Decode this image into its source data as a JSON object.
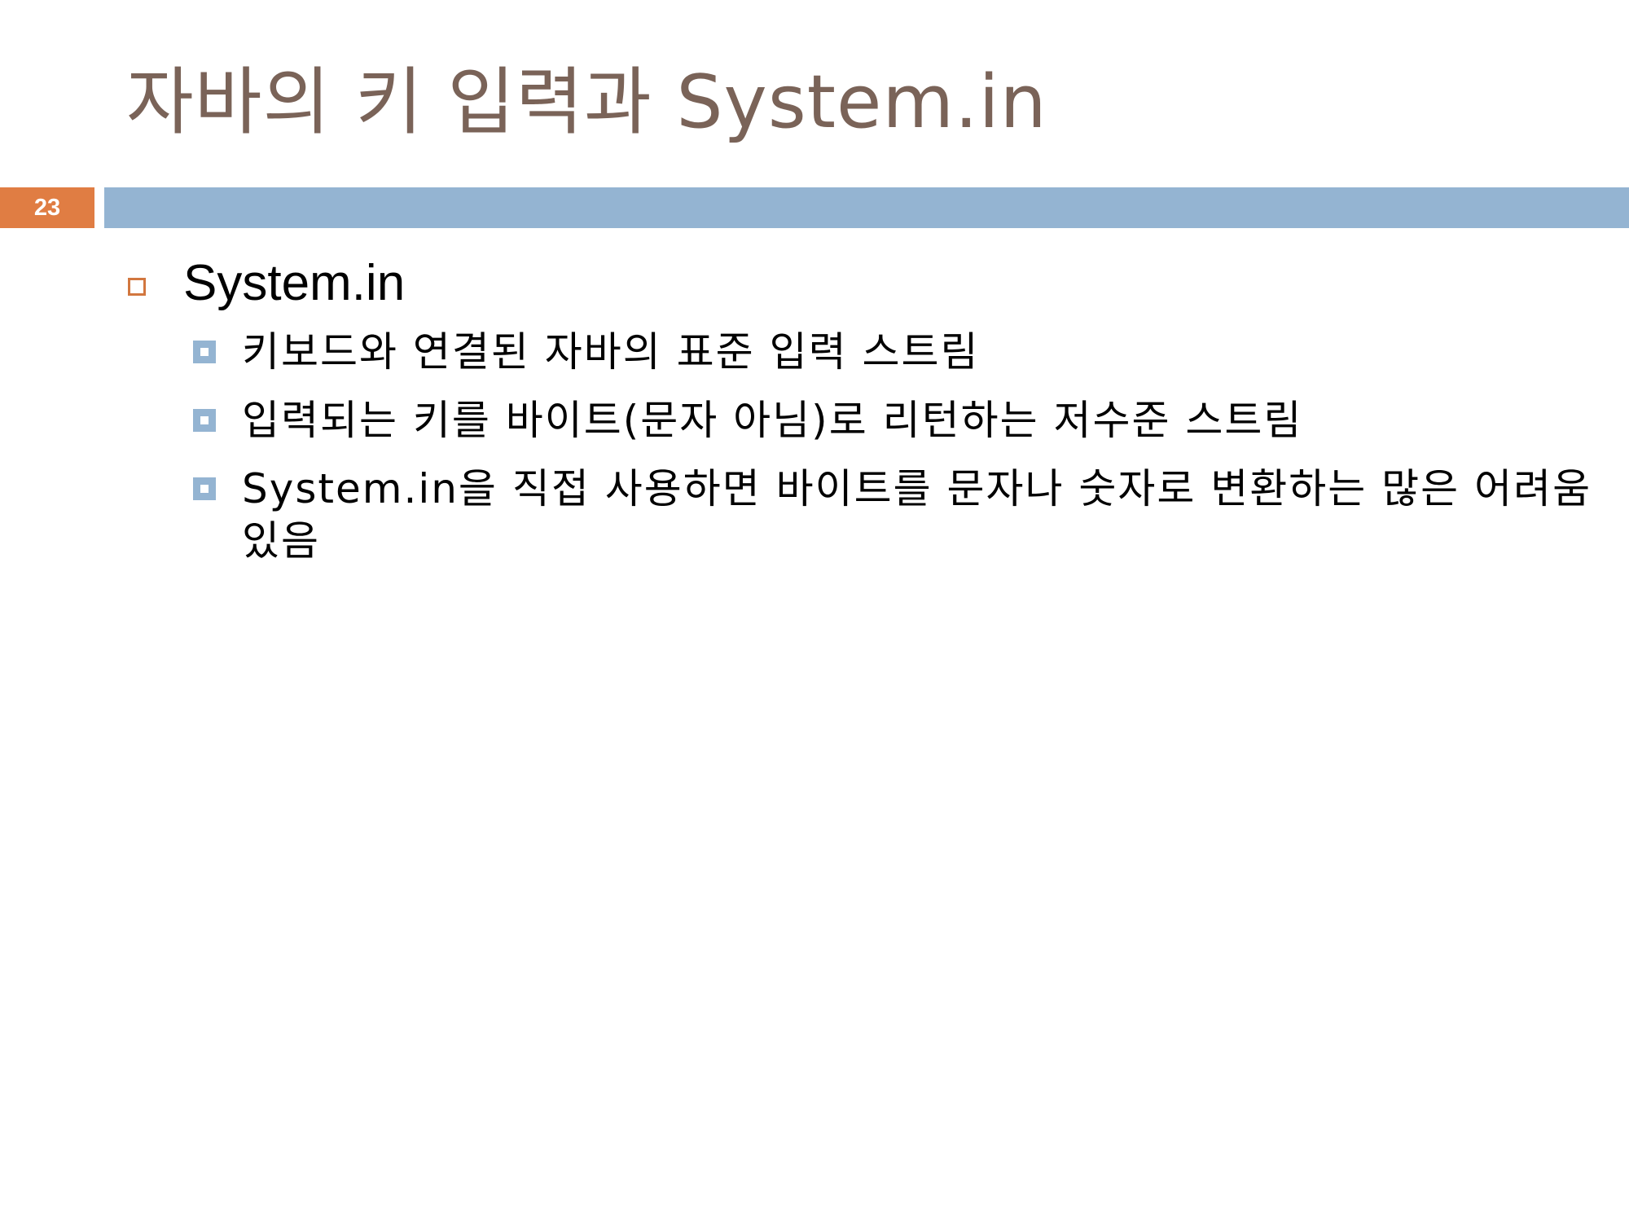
{
  "slide": {
    "title": "자바의 키 입력과 System.in",
    "page_number": "23"
  },
  "colors": {
    "title": "#7a6358",
    "badge": "#e07d43",
    "header_rule": "#94b4d2",
    "level1_bullet": "#d2773f",
    "level2_bullet": "#94b4d2"
  },
  "content": {
    "heading": "System.in",
    "bullets": [
      "키보드와 연결된 자바의 표준 입력 스트림",
      "입력되는 키를 바이트(문자 아님)로 리턴하는 저수준 스트림",
      "System.in을 직접 사용하면 바이트를 문자나 숫자로 변환하는 많은 어려움 있음"
    ]
  }
}
